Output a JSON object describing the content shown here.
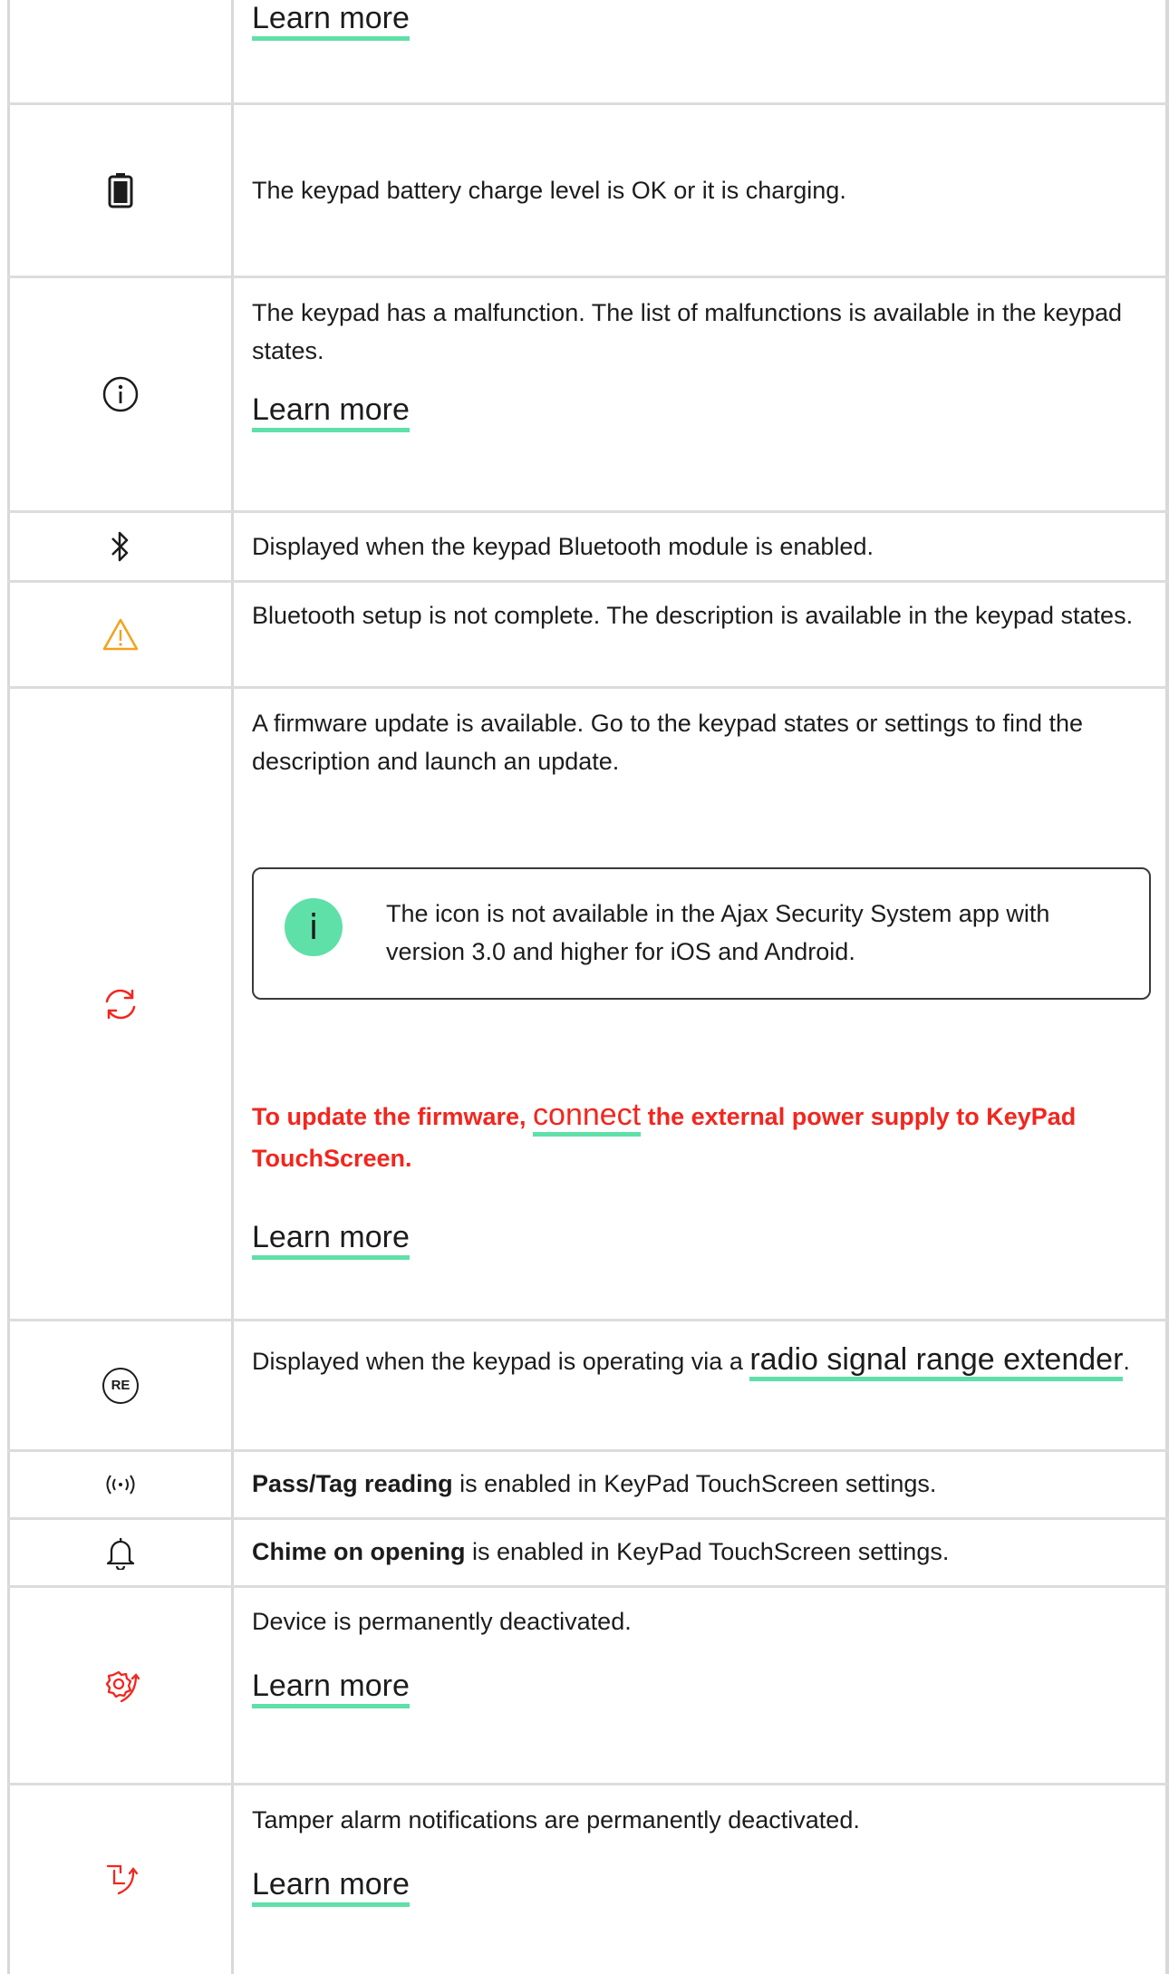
{
  "colors": {
    "accent": "#5fe0a8",
    "alert_red": "#f2261e",
    "warning_amber": "#f2a21b",
    "border": "#d8d8d8"
  },
  "rows": [
    {
      "icon": "none",
      "learn_more": "Learn more"
    },
    {
      "icon": "battery-icon",
      "text": "The keypad battery charge level is OK or it is charging."
    },
    {
      "icon": "info-circle-icon",
      "text": "The keypad has a malfunction. The list of malfunctions is available in the keypad states.",
      "learn_more": "Learn more"
    },
    {
      "icon": "bluetooth-icon",
      "text": "Displayed when the keypad Bluetooth module is enabled."
    },
    {
      "icon": "warning-triangle-icon",
      "text": "Bluetooth setup is not complete. The description is available in the keypad states."
    },
    {
      "icon": "update-arrows-icon",
      "text": "A firmware update is available. Go to the keypad states or settings to find the description and launch an update.",
      "note": {
        "badge": "i",
        "text": "The icon is not available in the Ajax Security System app with version 3.0 and higher for iOS and Android."
      },
      "warning": {
        "before": "To update the firmware, ",
        "link": "connect",
        "after": " the external power supply to KeyPad TouchScreen."
      },
      "learn_more": "Learn more"
    },
    {
      "icon": "range-extender-icon",
      "icon_label": "RE",
      "text_before": "Displayed when the keypad is operating via a ",
      "link": "radio signal range extender",
      "text_after": "."
    },
    {
      "icon": "pass-tag-reading-icon",
      "bold": "Pass/Tag reading",
      "text": " is enabled in KeyPad TouchScreen settings."
    },
    {
      "icon": "bell-icon",
      "bold": "Chime on opening",
      "text": " is enabled in KeyPad TouchScreen settings."
    },
    {
      "icon": "deactivated-gear-icon",
      "text": "Device is permanently deactivated.",
      "learn_more": "Learn more"
    },
    {
      "icon": "tamper-deactivated-icon",
      "text": "Tamper alarm notifications are permanently deactivated.",
      "learn_more": "Learn more"
    }
  ]
}
